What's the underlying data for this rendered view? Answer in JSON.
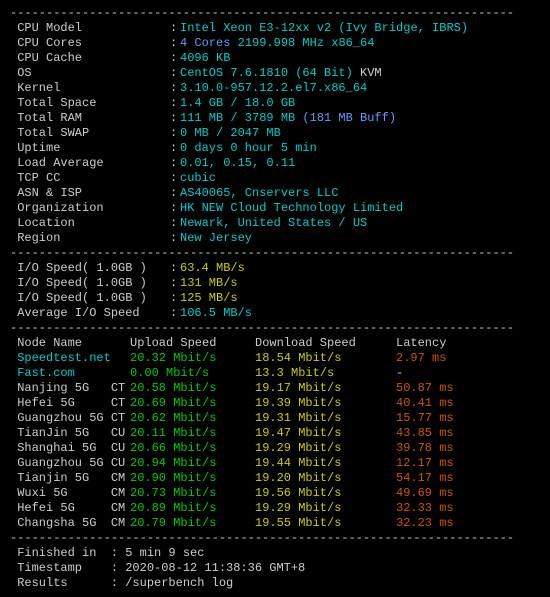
{
  "sys": {
    "cpu_model_label": " CPU Model",
    "cpu_model_value": "Intel Xeon E3-12xx v2 (Ivy Bridge, IBRS)",
    "cpu_cores_label": " CPU Cores",
    "cpu_cores_count": "4 Cores",
    "cpu_cores_freq": " 2199.998 MHz x86_64",
    "cpu_cache_label": " CPU Cache",
    "cpu_cache_value": "4096 KB",
    "os_label": " OS",
    "os_value": "CentOS 7.6.1810 (64 Bit)",
    "os_kvm": " KVM",
    "kernel_label": " Kernel",
    "kernel_value": "3.10.0-957.12.2.el7.x86_64",
    "total_space_label": " Total Space",
    "total_space_value": "1.4 GB / 18.0 GB",
    "total_ram_label": " Total RAM",
    "total_ram_value": "111 MB / 3789 MB",
    "total_ram_buff": " (181 MB Buff)",
    "total_swap_label": " Total SWAP",
    "total_swap_value": "0 MB / 2047 MB",
    "uptime_label": " Uptime",
    "uptime_value": "0 days 0 hour 5 min",
    "load_label": " Load Average",
    "load_value": "0.01, 0.15, 0.11",
    "tcp_label": " TCP CC",
    "tcp_value": "cubic",
    "asn_label": " ASN & ISP",
    "asn_value": "AS40065, Cnservers LLC",
    "org_label": " Organization",
    "org_value": "HK NEW Cloud Technology Limited",
    "loc_label": " Location",
    "loc_value": "Newark, United States / US",
    "region_label": " Region",
    "region_value": "New Jersey"
  },
  "io": {
    "label1": " I/O Speed( 1.0GB )",
    "val1": "63.4 MB/s",
    "label2": " I/O Speed( 1.0GB )",
    "val2": "131 MB/s",
    "label3": " I/O Speed( 1.0GB )",
    "val3": "125 MB/s",
    "avg_label": " Average I/O Speed",
    "avg_value": "106.5 MB/s"
  },
  "hdr": {
    "node": " Node Name",
    "up": "Upload Speed",
    "dl": "Download Speed",
    "lat": "Latency"
  },
  "speed": [
    {
      "node": " Speedtest.net",
      "up": "20.32 Mbit/s",
      "dl": "18.54 Mbit/s",
      "lat": "2.97 ms"
    },
    {
      "node": " Fast.com",
      "up": "0.00 Mbit/s",
      "dl": "13.3 Mbit/s",
      "lat": "-"
    },
    {
      "node": " Nanjing 5G   CT",
      "up": "20.58 Mbit/s",
      "dl": "19.17 Mbit/s",
      "lat": "50.87 ms"
    },
    {
      "node": " Hefei 5G     CT",
      "up": "20.69 Mbit/s",
      "dl": "19.39 Mbit/s",
      "lat": "40.41 ms"
    },
    {
      "node": " Guangzhou 5G CT",
      "up": "20.62 Mbit/s",
      "dl": "19.31 Mbit/s",
      "lat": "15.77 ms"
    },
    {
      "node": " TianJin 5G   CU",
      "up": "20.11 Mbit/s",
      "dl": "19.47 Mbit/s",
      "lat": "43.85 ms"
    },
    {
      "node": " Shanghai 5G  CU",
      "up": "20.66 Mbit/s",
      "dl": "19.29 Mbit/s",
      "lat": "39.78 ms"
    },
    {
      "node": " Guangzhou 5G CU",
      "up": "20.94 Mbit/s",
      "dl": "19.44 Mbit/s",
      "lat": "12.17 ms"
    },
    {
      "node": " Tianjin 5G   CM",
      "up": "20.90 Mbit/s",
      "dl": "19.20 Mbit/s",
      "lat": "54.17 ms"
    },
    {
      "node": " Wuxi 5G      CM",
      "up": "20.73 Mbit/s",
      "dl": "19.56 Mbit/s",
      "lat": "49.69 ms"
    },
    {
      "node": " Hefei 5G     CM",
      "up": "20.89 Mbit/s",
      "dl": "19.29 Mbit/s",
      "lat": "32.33 ms"
    },
    {
      "node": " Changsha 5G  CM",
      "up": "20.79 Mbit/s",
      "dl": "19.55 Mbit/s",
      "lat": "32.23 ms"
    }
  ],
  "footer": {
    "finished": " Finished in  : 5 min 9 sec",
    "timestamp": " Timestamp    : 2020-08-12 11:38:36 GMT+8",
    "results": " Results      : /superbench log"
  },
  "dash": "----------------------------------------------------------------------"
}
